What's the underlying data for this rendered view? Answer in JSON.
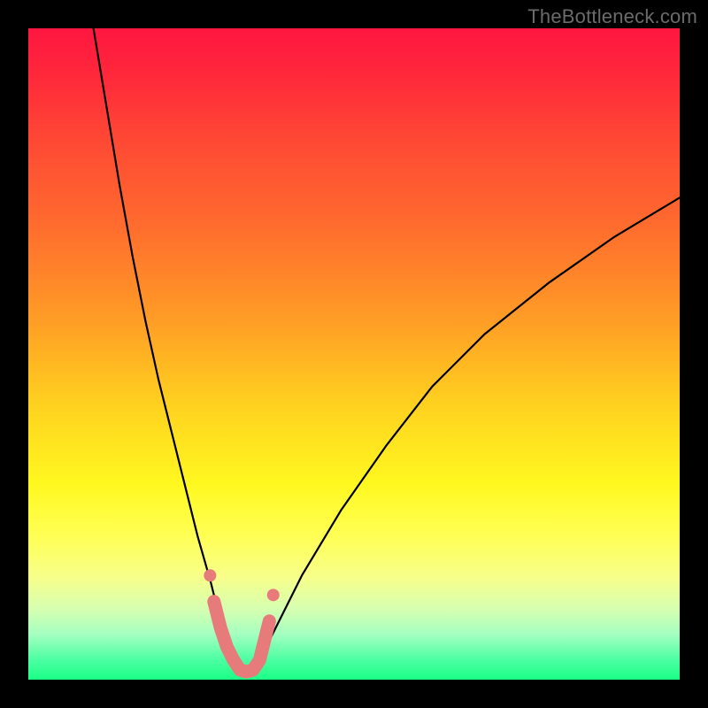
{
  "watermark": "TheBottleneck.com",
  "colors": {
    "frame": "#000000",
    "watermark": "#6b6b6b",
    "curve": "#000000",
    "marker_stroke": "#e77a7a",
    "marker_fill": "#e77a7a",
    "gradient_stops": [
      "#ff1640",
      "#ff2a3a",
      "#ff4535",
      "#ff6b2e",
      "#ff9a26",
      "#ffd21f",
      "#fff820",
      "#ffff55",
      "#f8ff88",
      "#d8ffb0",
      "#a5ffc0",
      "#4bffa2",
      "#1aff85"
    ]
  },
  "chart_data": {
    "type": "line",
    "title": "",
    "xlabel": "",
    "ylabel": "",
    "xlim": [
      0,
      100
    ],
    "ylim": [
      0,
      100
    ],
    "series": [
      {
        "name": "bottleneck-curve",
        "x": [
          10,
          12,
          14,
          16,
          18,
          20,
          22,
          24,
          26,
          28,
          29,
          30,
          31,
          32,
          33,
          34,
          35,
          36,
          38,
          42,
          48,
          55,
          62,
          70,
          80,
          90,
          100
        ],
        "y": [
          100,
          88,
          76,
          65,
          55,
          46,
          38,
          30,
          22,
          15,
          11,
          7,
          4,
          2,
          1,
          1,
          2,
          4,
          8,
          16,
          26,
          36,
          45,
          53,
          61,
          68,
          74
        ]
      }
    ],
    "markers": {
      "name": "highlight-segment",
      "x": [
        28.5,
        29.5,
        30.5,
        31.5,
        32.5,
        33.5,
        34.5,
        35.5,
        36.0,
        37.0
      ],
      "y": [
        12,
        8,
        5,
        3,
        1.5,
        1.2,
        1.5,
        3,
        5,
        9
      ]
    }
  }
}
